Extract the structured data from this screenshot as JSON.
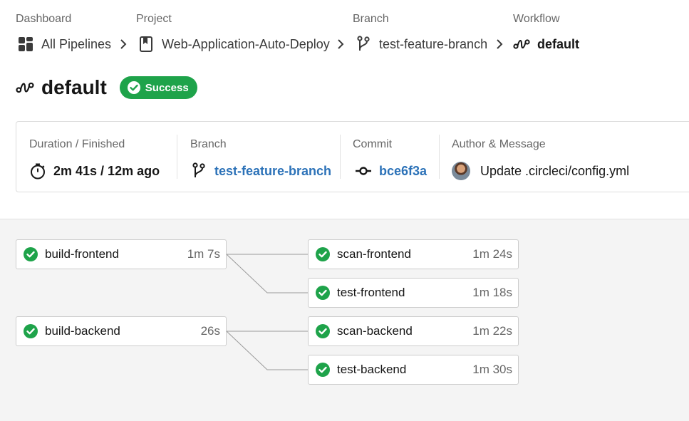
{
  "breadcrumb": {
    "dashboard": {
      "label": "Dashboard",
      "value": "All Pipelines",
      "icon": "dashboard-grid-icon"
    },
    "project": {
      "label": "Project",
      "value": "Web-Application-Auto-Deploy",
      "icon": "bookmark-icon"
    },
    "branch": {
      "label": "Branch",
      "value": "test-feature-branch",
      "icon": "git-branch-icon"
    },
    "workflow": {
      "label": "Workflow",
      "value": "default",
      "icon": "workflow-icon"
    }
  },
  "header": {
    "title": "default",
    "status": "Success",
    "status_color": "#1ea34a"
  },
  "summary": {
    "duration": {
      "label": "Duration / Finished",
      "value": "2m 41s / 12m ago"
    },
    "branch": {
      "label": "Branch",
      "value": "test-feature-branch"
    },
    "commit": {
      "label": "Commit",
      "value": "bce6f3a"
    },
    "author": {
      "label": "Author & Message",
      "message": "Update .circleci/config.yml"
    }
  },
  "jobs": [
    {
      "name": "build-frontend",
      "duration": "1m 7s",
      "status": "success"
    },
    {
      "name": "scan-frontend",
      "duration": "1m 24s",
      "status": "success"
    },
    {
      "name": "test-frontend",
      "duration": "1m 18s",
      "status": "success"
    },
    {
      "name": "build-backend",
      "duration": "26s",
      "status": "success"
    },
    {
      "name": "scan-backend",
      "duration": "1m 22s",
      "status": "success"
    },
    {
      "name": "test-backend",
      "duration": "1m 30s",
      "status": "success"
    }
  ],
  "colors": {
    "success": "#1ea34a",
    "link": "#2c72b8",
    "graph_bg": "#f4f4f4"
  }
}
